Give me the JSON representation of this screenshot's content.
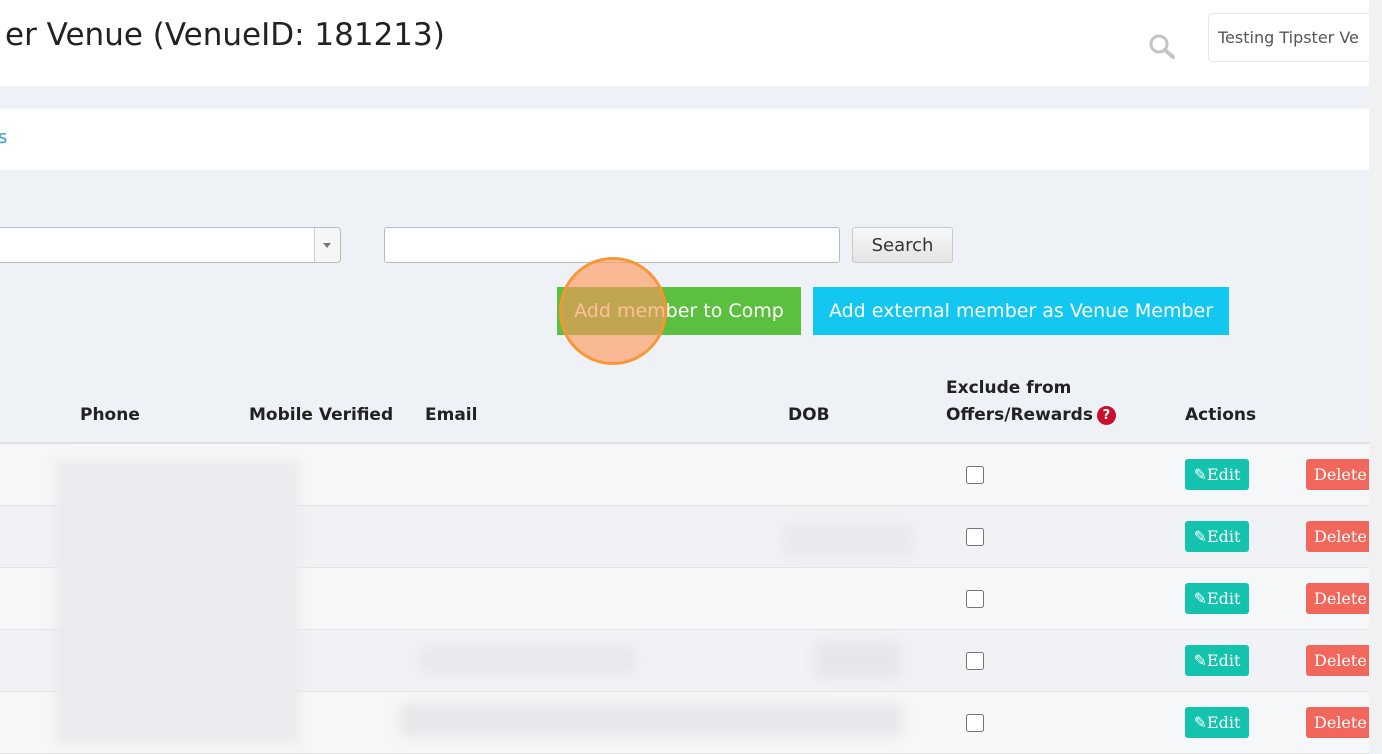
{
  "header": {
    "title": "er Venue (VenueID: 181213)",
    "venue_selector_value": "Testing Tipster Ve",
    "search_icon": "search-icon"
  },
  "breadcrumb": {
    "fragment": "s"
  },
  "filters": {
    "select_value": "",
    "search_value": "",
    "search_button": "Search"
  },
  "actions": {
    "add_member_to_comp": "Add member to Comp",
    "add_external_member": "Add external member as Venue Member"
  },
  "table": {
    "columns": {
      "phone": "Phone",
      "mobile_verified": "Mobile Verified",
      "email": "Email",
      "dob": "DOB",
      "exclude_line1": "Exclude from",
      "exclude_line2": "Offers/Rewards",
      "actions": "Actions"
    },
    "help_glyph": "?",
    "edit_label": "Edit",
    "delete_label": "Delete",
    "rows": [
      {
        "exclude": false
      },
      {
        "exclude": false
      },
      {
        "exclude": false
      },
      {
        "exclude": false
      },
      {
        "exclude": false
      }
    ]
  },
  "colors": {
    "green_button": "#5bbf3f",
    "cyan_button": "#13c8f0",
    "edit_button": "#13c3ae",
    "delete_button": "#f2675c",
    "help_icon": "#c8102e",
    "click_marker": "#f59a50"
  }
}
